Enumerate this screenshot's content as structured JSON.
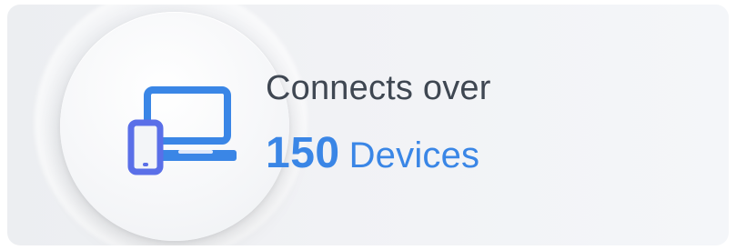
{
  "feature_card": {
    "headline": "Connects over",
    "count_number": "150",
    "count_label": "Devices",
    "icon": "laptop-and-phone-icon",
    "colors": {
      "accent": "#3a86e6",
      "headline_text": "#3f4752",
      "icon_primary": "#3a86e6",
      "icon_secondary": "#5a6fe8"
    }
  }
}
